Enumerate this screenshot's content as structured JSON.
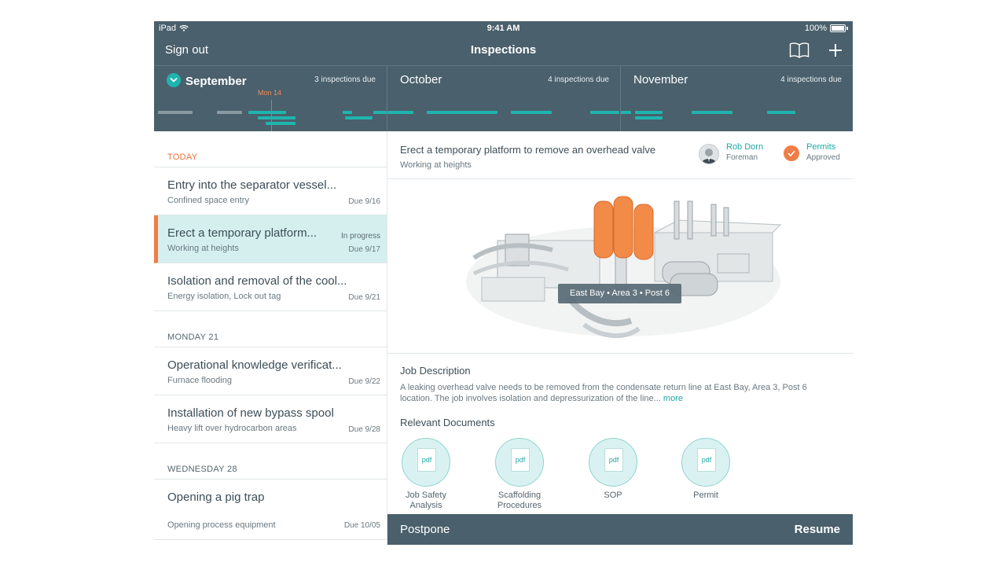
{
  "status_bar": {
    "device": "iPad",
    "time": "9:41 AM",
    "battery": "100%"
  },
  "nav": {
    "sign_out": "Sign out",
    "title": "Inspections"
  },
  "timeline": {
    "months": [
      {
        "name": "September",
        "due": "3 inspections due"
      },
      {
        "name": "October",
        "due": "4 inspections due"
      },
      {
        "name": "November",
        "due": "4 inspections due"
      }
    ],
    "today_marker": "Mon 14"
  },
  "list": {
    "sections": [
      {
        "label": "TODAY"
      },
      {
        "label": "MONDAY  21"
      },
      {
        "label": "WEDNESDAY 28"
      }
    ],
    "items": [
      {
        "title": "Entry into the separator vessel...",
        "subtitle": "Confined space entry",
        "due": "Due 9/16"
      },
      {
        "title": "Erect a temporary platform...",
        "subtitle": "Working at heights",
        "due": "Due 9/17",
        "status": "In progress"
      },
      {
        "title": "Isolation and removal of the cool...",
        "subtitle": "Energy isolation, Lock out tag",
        "due": "Due 9/21"
      },
      {
        "title": "Operational knowledge verificat...",
        "subtitle": "Furnace flooding",
        "due": "Due 9/22"
      },
      {
        "title": "Installation of new bypass spool",
        "subtitle": "Heavy lift over hydrocarbon areas",
        "due": "Due 9/28"
      },
      {
        "title": "Opening a pig trap",
        "subtitle": "Opening process equipment",
        "due": "Due 10/05"
      }
    ]
  },
  "detail": {
    "title": "Erect a temporary platform to remove an overhead valve",
    "subtitle": "Working at heights",
    "person": {
      "name": "Rob Dorn",
      "role": "Foreman"
    },
    "permit": {
      "name": "Permits",
      "status": "Approved"
    },
    "location": "East Bay • Area 3 • Post 6",
    "job_description_title": "Job Description",
    "job_description": "A leaking overhead valve needs to be removed from the condensate return line at East Bay, Area 3, Post 6 location. The job involves isolation and depressurization of the line...",
    "more": "more",
    "documents_title": "Relevant Documents",
    "documents": [
      {
        "type": "pdf",
        "label": "Job Safety Analysis"
      },
      {
        "type": "pdf",
        "label": "Scaffolding Procedures"
      },
      {
        "type": "pdf",
        "label": "SOP"
      },
      {
        "type": "pdf",
        "label": "Permit"
      }
    ]
  },
  "footer": {
    "postpone": "Postpone",
    "resume": "Resume"
  }
}
